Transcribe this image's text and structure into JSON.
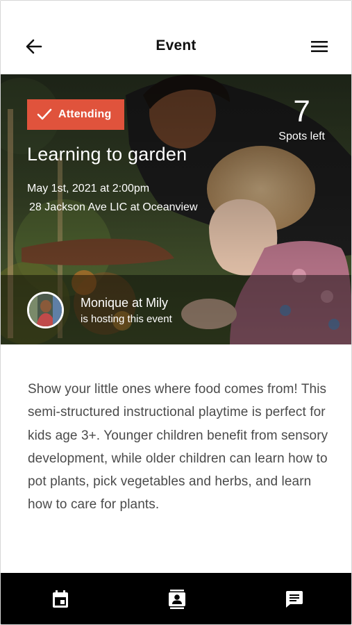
{
  "header": {
    "title": "Event",
    "back_icon": "arrow-left-icon",
    "menu_icon": "hamburger-menu-icon"
  },
  "hero": {
    "badge": {
      "label": "Attending",
      "icon": "checkmark-icon",
      "color": "#e0533c"
    },
    "spots": {
      "count": "7",
      "label": "Spots left"
    },
    "title": "Learning to garden",
    "date": "May 1st, 2021 at 2:00pm",
    "location": "28 Jackson Ave LIC at Oceanview",
    "host": {
      "name": "Monique at Mily",
      "subtitle": "is hosting this event"
    }
  },
  "description": "Show your little ones where food comes from! This semi-structured instructional playtime is perfect for kids age 3+. Younger children benefit from sensory development, while older children can learn how to pot plants, pick vegetables and herbs, and learn how to care for plants.",
  "bottom_nav": {
    "items": [
      {
        "icon": "calendar-icon"
      },
      {
        "icon": "contact-card-icon"
      },
      {
        "icon": "chat-icon"
      }
    ],
    "background": "#000000"
  }
}
